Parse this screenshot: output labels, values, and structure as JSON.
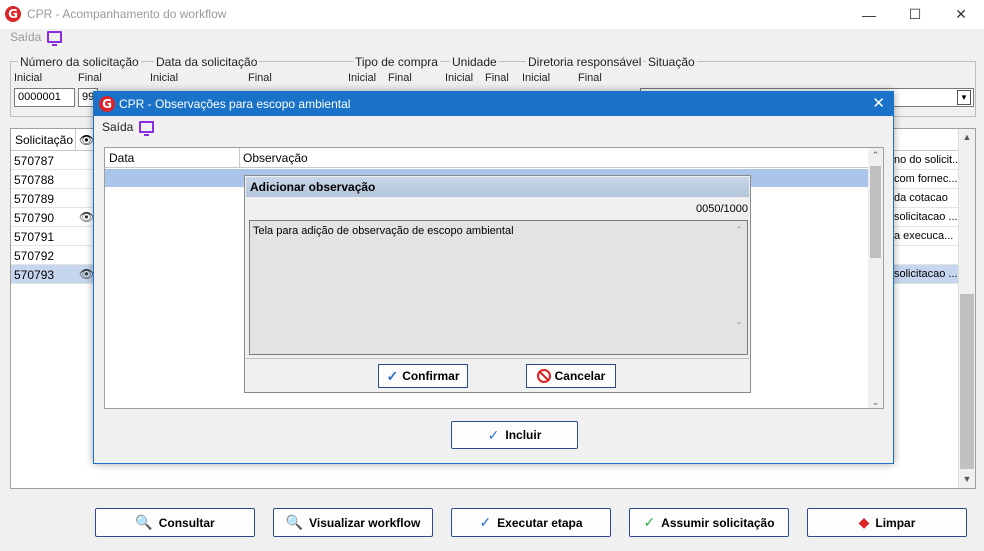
{
  "window": {
    "title": "CPR - Acompanhamento do workflow",
    "logo_letter": "G",
    "min_glyph": "—",
    "max_glyph": "☐",
    "close_glyph": "✕"
  },
  "menu": {
    "exit_label": "Saída",
    "exit_icon": "monitor-icon"
  },
  "filters": {
    "numero": {
      "legend": "Número da solicitação",
      "inicial_label": "Inicial",
      "final_label": "Final",
      "inicial_value": "0000001",
      "final_value": "99"
    },
    "data": {
      "legend": "Data da solicitação",
      "inicial_label": "Inicial",
      "final_label": "Final"
    },
    "tipo": {
      "legend": "Tipo de compra",
      "inicial_label": "Inicial",
      "final_label": "Final"
    },
    "unidade": {
      "legend": "Unidade",
      "inicial_label": "Inicial",
      "final_label": "Final"
    },
    "diretoria": {
      "legend": "Diretoria responsável",
      "inicial_label": "Inicial",
      "final_label": "Final"
    },
    "situacao": {
      "legend": "Situação",
      "value": ""
    }
  },
  "grid": {
    "col_solicitacao": "Solicitação",
    "rows": [
      {
        "id": "570787",
        "eye": "",
        "obs": "no do solicit..."
      },
      {
        "id": "570788",
        "eye": "",
        "obs": "com fornec..."
      },
      {
        "id": "570789",
        "eye": "",
        "obs": "da cotacao"
      },
      {
        "id": "570790",
        "eye": "👁",
        "obs": "solicitacao ..."
      },
      {
        "id": "570791",
        "eye": "",
        "obs": "a execuca..."
      },
      {
        "id": "570792",
        "eye": "",
        "obs": ""
      },
      {
        "id": "570793",
        "eye": "👁",
        "obs": "solicitacao ..."
      }
    ]
  },
  "buttons": {
    "consultar": "Consultar",
    "visualizar": "Visualizar workflow",
    "executar": "Executar etapa",
    "assumir": "Assumir solicitação",
    "limpar": "Limpar"
  },
  "dialog": {
    "title": "CPR - Observações para escopo ambiental",
    "exit_label": "Saída",
    "col_data": "Data",
    "col_obs": "Observação",
    "include_button": "Incluir",
    "add_panel": {
      "header": "Adicionar observação",
      "counter": "0050/1000",
      "text": "Tela para adição de observação de escopo ambiental",
      "confirm": "Confirmar",
      "cancel": "Cancelar"
    }
  },
  "colors": {
    "accent": "#1a73c9",
    "selected_row": "#c5d6ee",
    "brand_red": "#d9252a",
    "menu_icon": "#8a2be2"
  }
}
